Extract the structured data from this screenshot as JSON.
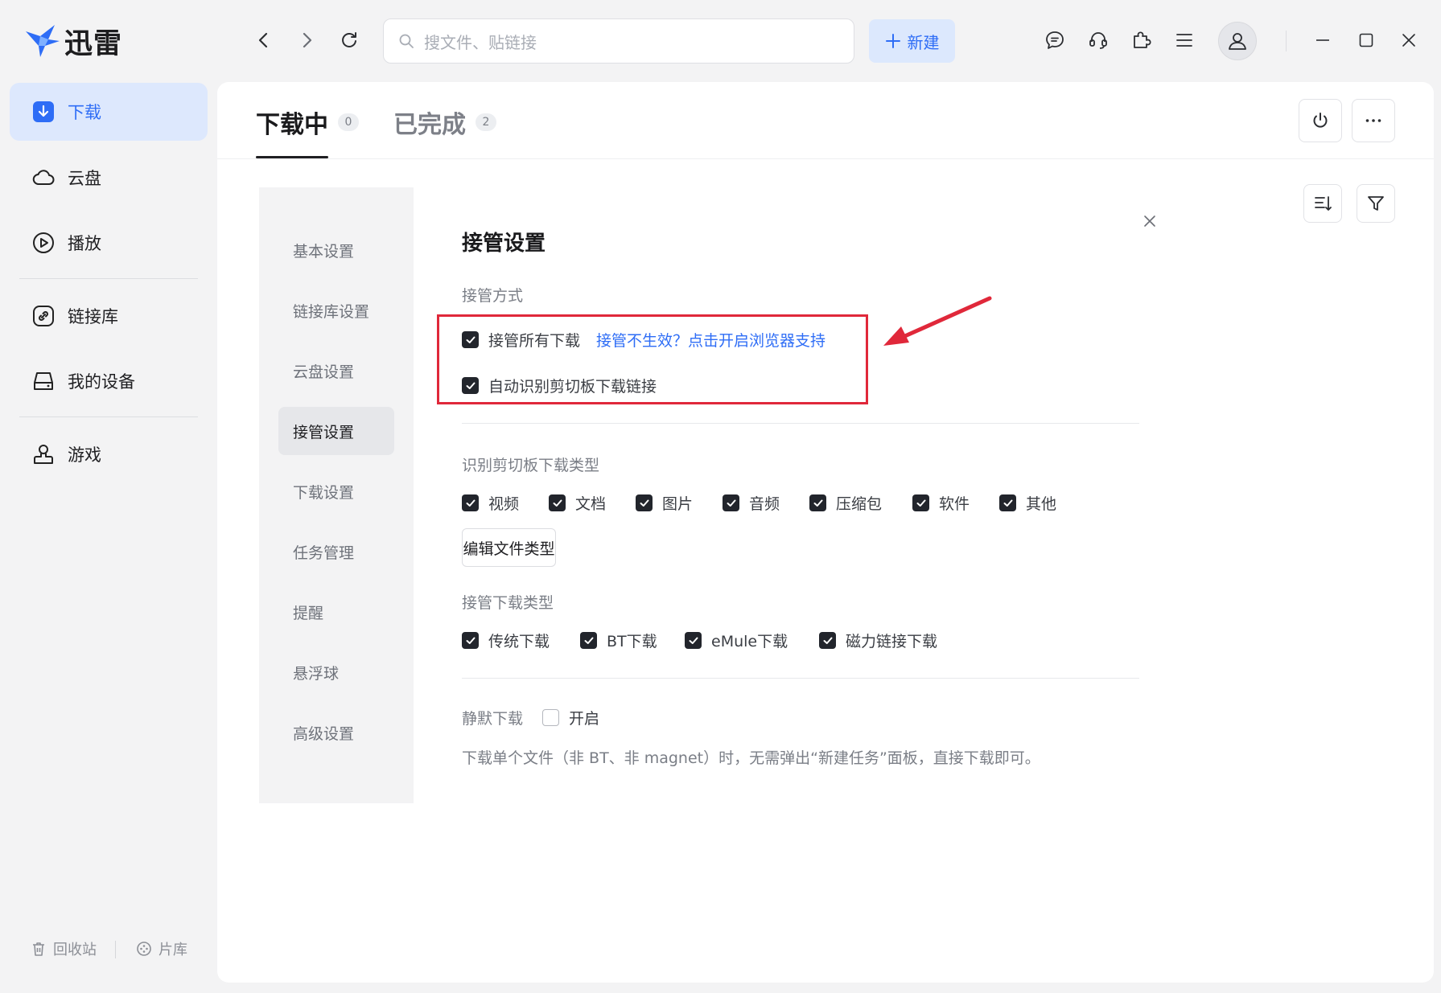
{
  "app": {
    "name": "迅雷",
    "brand_color": "#2e6df6"
  },
  "search": {
    "placeholder": "搜文件、贴链接"
  },
  "toolbar": {
    "new_label": "新建"
  },
  "sidebar": {
    "items": [
      {
        "label": "下载",
        "icon": "download-icon",
        "active": true
      },
      {
        "label": "云盘",
        "icon": "cloud-icon"
      },
      {
        "label": "播放",
        "icon": "play-icon"
      },
      {
        "label": "链接库",
        "icon": "link-icon"
      },
      {
        "label": "我的设备",
        "icon": "device-icon"
      },
      {
        "label": "游戏",
        "icon": "game-icon"
      }
    ],
    "bottom": [
      {
        "label": "回收站",
        "icon": "trash-icon"
      },
      {
        "label": "片库",
        "icon": "film-library-icon"
      }
    ]
  },
  "tabs": [
    {
      "label": "下载中",
      "count": "0",
      "active": true
    },
    {
      "label": "已完成",
      "count": "2"
    }
  ],
  "settings": {
    "nav": [
      "基本设置",
      "链接库设置",
      "云盘设置",
      "接管设置",
      "下载设置",
      "任务管理",
      "提醒",
      "悬浮球",
      "高级设置"
    ],
    "active_nav": "接管设置",
    "title": "接管设置",
    "takeover_mode": {
      "label": "接管方式",
      "all_downloads": {
        "label": "接管所有下载",
        "checked": true,
        "link": "接管不生效？点击开启浏览器支持"
      },
      "clipboard": {
        "label": "自动识别剪切板下载链接",
        "checked": true
      }
    },
    "clipboard_types": {
      "label": "识别剪切板下载类型",
      "options": [
        {
          "label": "视频",
          "checked": true
        },
        {
          "label": "文档",
          "checked": true
        },
        {
          "label": "图片",
          "checked": true
        },
        {
          "label": "音频",
          "checked": true
        },
        {
          "label": "压缩包",
          "checked": true
        },
        {
          "label": "软件",
          "checked": true
        },
        {
          "label": "其他",
          "checked": true
        }
      ],
      "edit_button": "编辑文件类型"
    },
    "download_types": {
      "label": "接管下载类型",
      "options": [
        {
          "label": "传统下载",
          "checked": true
        },
        {
          "label": "BT下载",
          "checked": true
        },
        {
          "label": "eMule下载",
          "checked": true
        },
        {
          "label": "磁力链接下载",
          "checked": true
        }
      ]
    },
    "silent": {
      "label": "静默下载",
      "option": "开启",
      "checked": false,
      "description": "下载单个文件（非 BT、非 magnet）时，无需弹出“新建任务”面板，直接下载即可。"
    }
  },
  "annotation_color": "#e0283a"
}
